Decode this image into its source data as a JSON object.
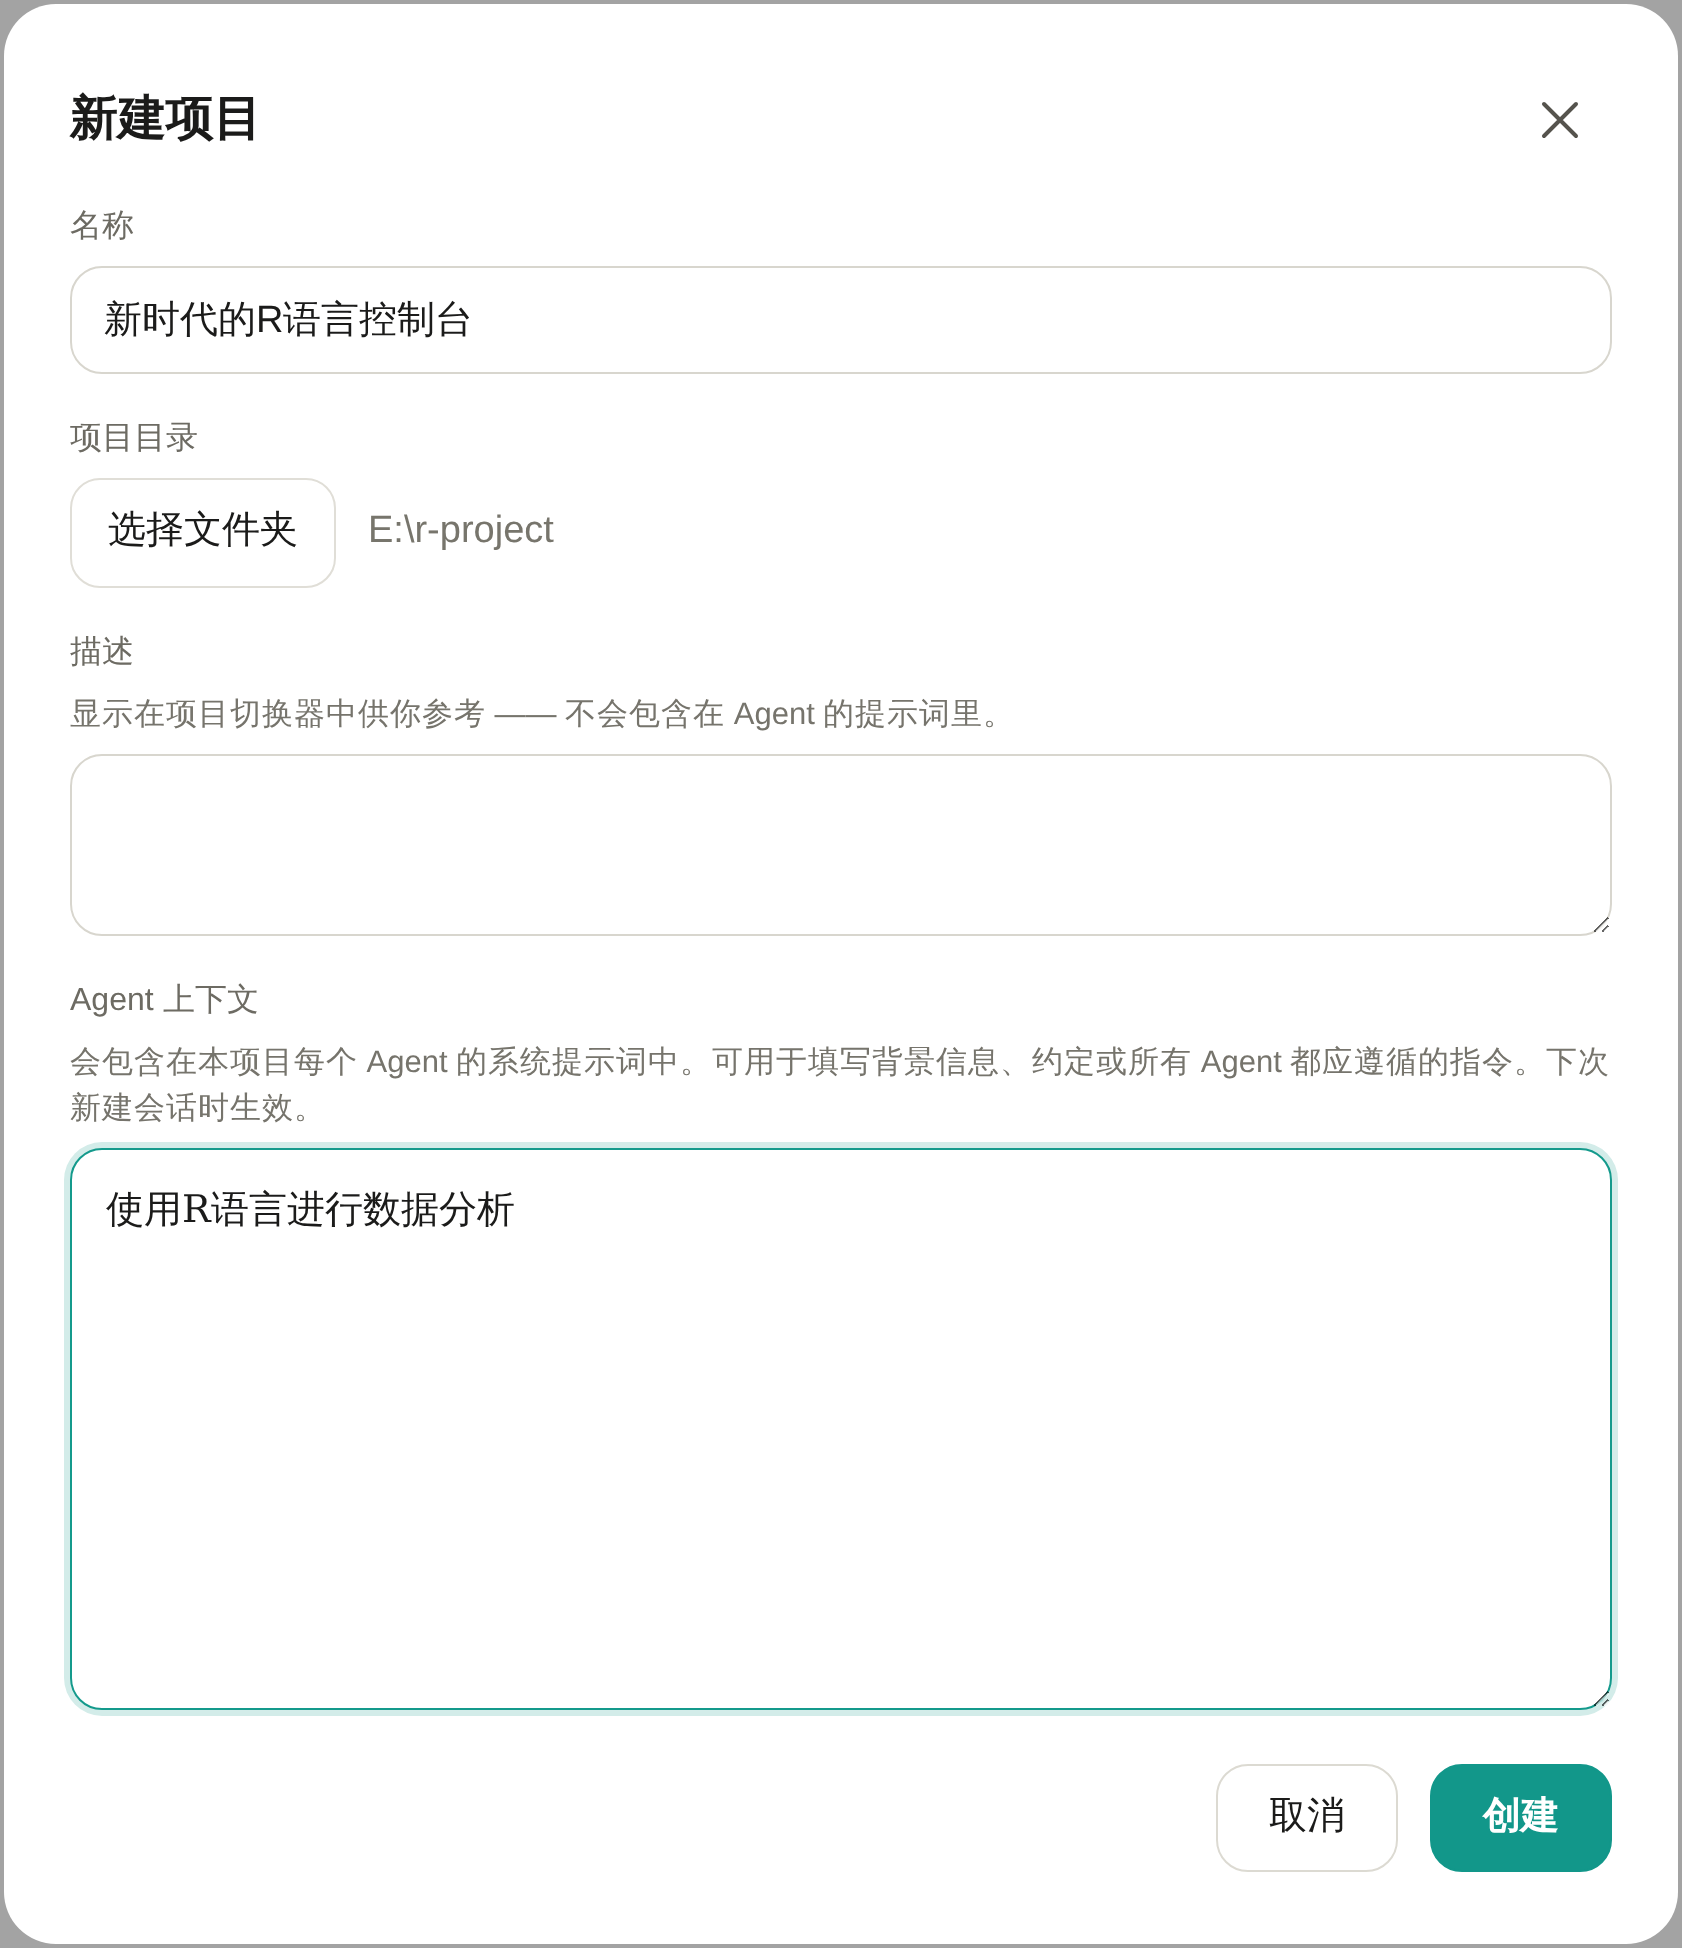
{
  "dialog": {
    "title": "新建项目"
  },
  "fields": [
    {
      "kind": "text",
      "label": "名称",
      "value": "新时代的R语言控制台"
    },
    {
      "kind": "folder",
      "label": "项目目录",
      "button": "选择文件夹",
      "path": "E:\\r-project"
    },
    {
      "kind": "textarea",
      "label": "描述",
      "hint": "显示在项目切换器中供你参考 —— 不会包含在 Agent 的提示词里。",
      "focused": false
    },
    {
      "kind": "textarea",
      "label": "Agent 上下文",
      "hint": "会包含在本项目每个 Agent 的系统提示词中。可用于填写背景信息、约定或所有 Agent 都应遵循的指令。下次新建会话时生效。",
      "value": "使用R语言进行数据分析",
      "focused": true
    }
  ],
  "buttons": [
    {
      "kind": "secondary",
      "label": "取消"
    },
    {
      "kind": "primary",
      "label": "创建"
    }
  ]
}
